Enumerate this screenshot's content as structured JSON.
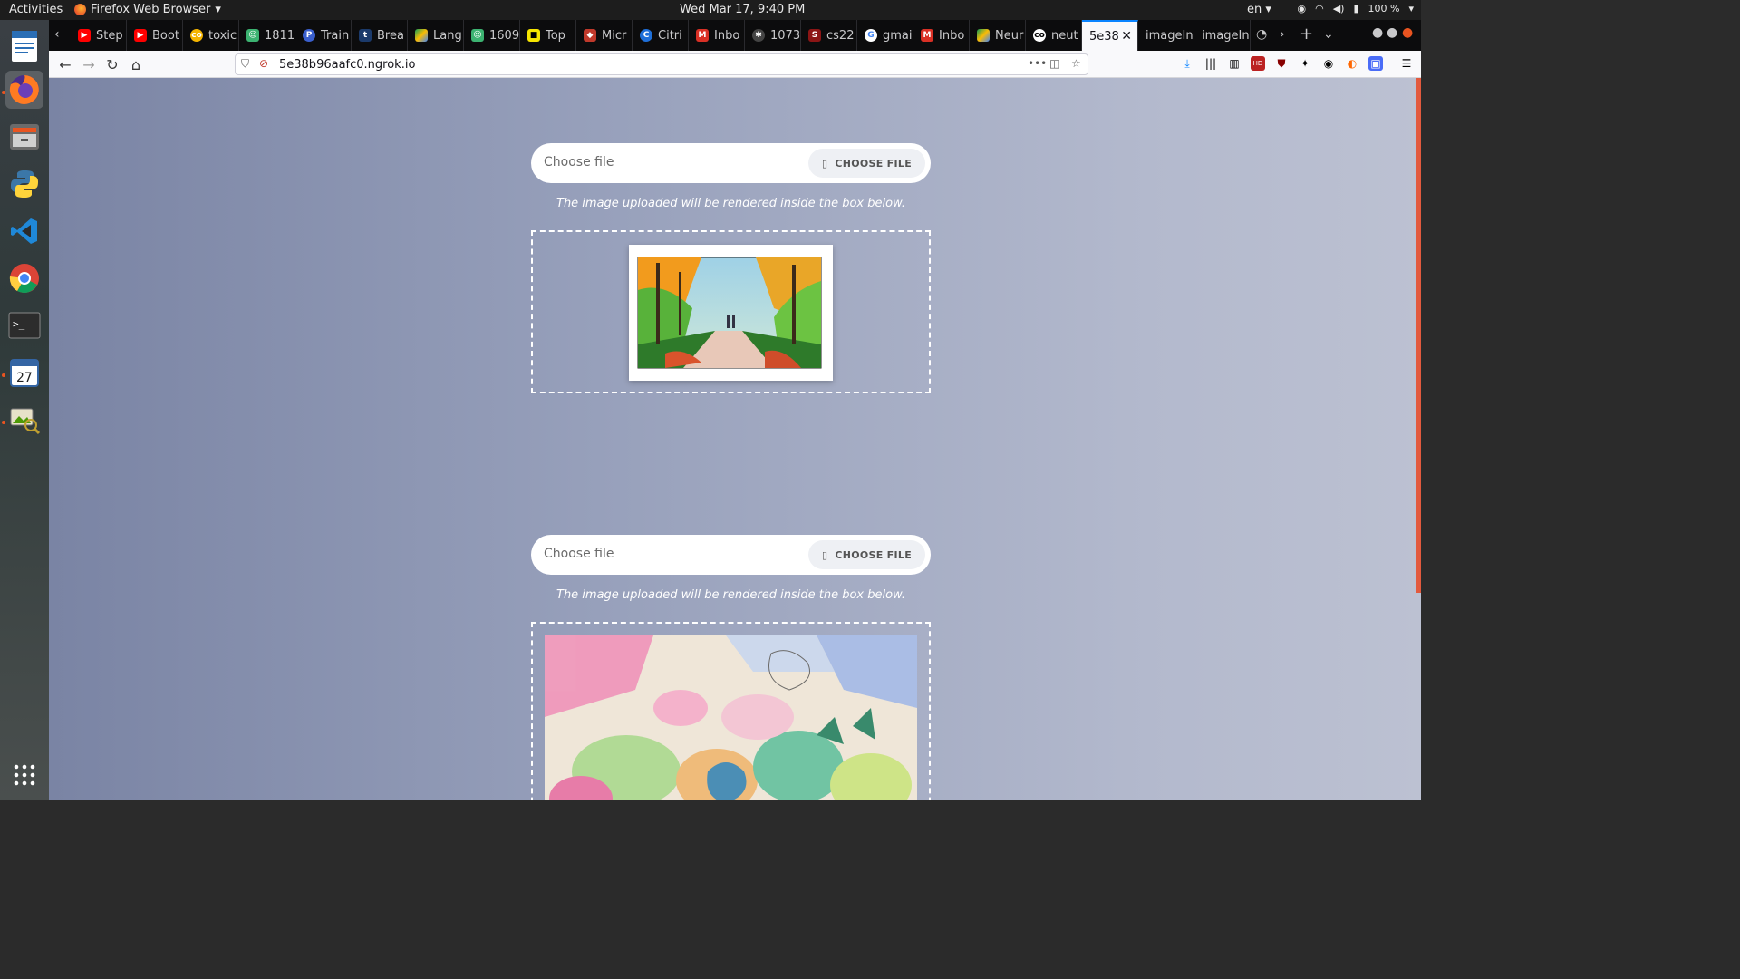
{
  "system": {
    "activities": "Activities",
    "app_name": "Firefox Web Browser",
    "clock": "Wed Mar 17,  9:40 PM",
    "lang": "en",
    "battery": "100 %"
  },
  "dock": {
    "items": [
      "writer-icon",
      "firefox-icon",
      "files-icon",
      "python-icon",
      "vscode-icon",
      "chrome-icon",
      "terminal-icon",
      "calendar-icon",
      "image-viewer-icon",
      "show-apps-icon"
    ],
    "calendar_day": "27"
  },
  "browser": {
    "tabs": [
      "Step",
      "Boot",
      "toxic",
      "1811",
      "Train",
      "Brea",
      "Lang",
      "1609",
      "Top",
      "Micr",
      "Citri",
      "Inbo",
      "1073",
      "cs22",
      "gmai",
      "Inbo",
      "Neur",
      "neut",
      "5e38",
      "imageIn",
      "imageIn"
    ],
    "selected_tab": "5e38",
    "url": "5e38b96aafc0.ngrok.io"
  },
  "uploaders": [
    {
      "placeholder": "Choose file",
      "button": "CHOOSE FILE",
      "note": "The image uploaded will be rendered inside the box below."
    },
    {
      "placeholder": "Choose file",
      "button": "CHOOSE FILE",
      "note": "The image uploaded will be rendered inside the box below."
    }
  ],
  "colors": {
    "accent": "#0a84ff",
    "page_bg": "#97a0bb"
  }
}
